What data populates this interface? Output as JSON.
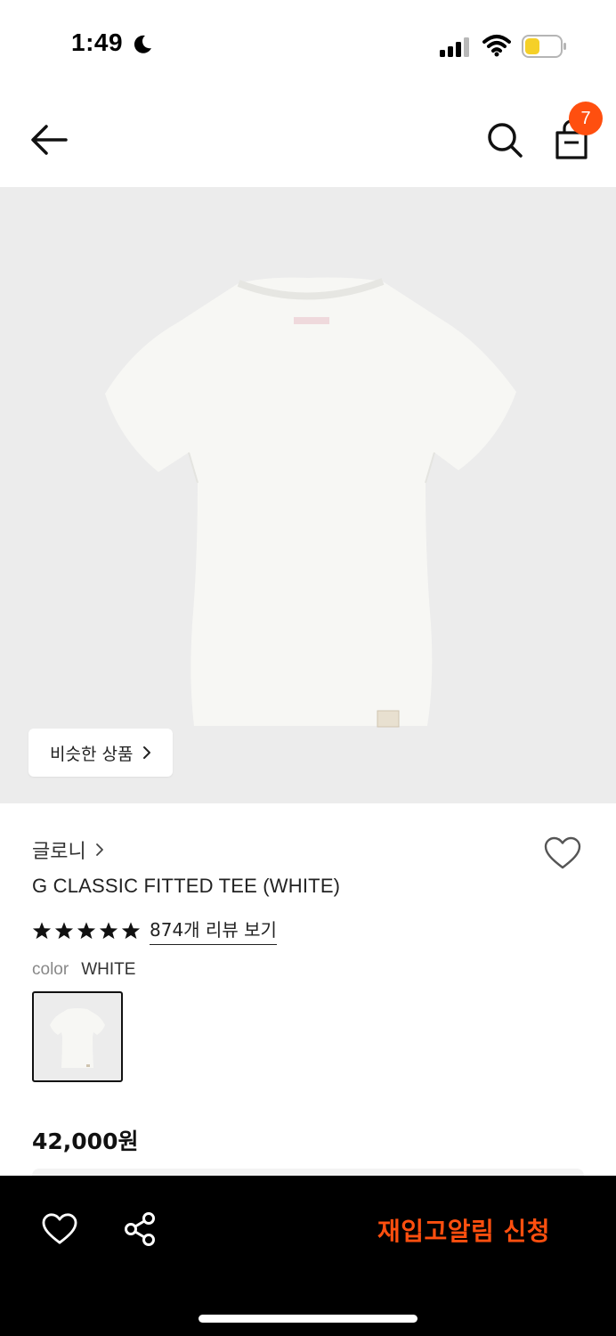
{
  "status_bar": {
    "time": "1:49",
    "battery_color": "#f5d028"
  },
  "header": {
    "cart_count": "7",
    "accent_color": "#ff4f0f"
  },
  "product": {
    "similar_button_label": "비슷한 상품",
    "brand": "글로니",
    "title": "G CLASSIC FITTED TEE (WHITE)",
    "rating_stars": 5,
    "review_link": "874개 리뷰 보기",
    "color_label": "color",
    "color_value": "WHITE",
    "price": "42,000원"
  },
  "bottom_bar": {
    "restock_label": "재입고알림 신청"
  }
}
